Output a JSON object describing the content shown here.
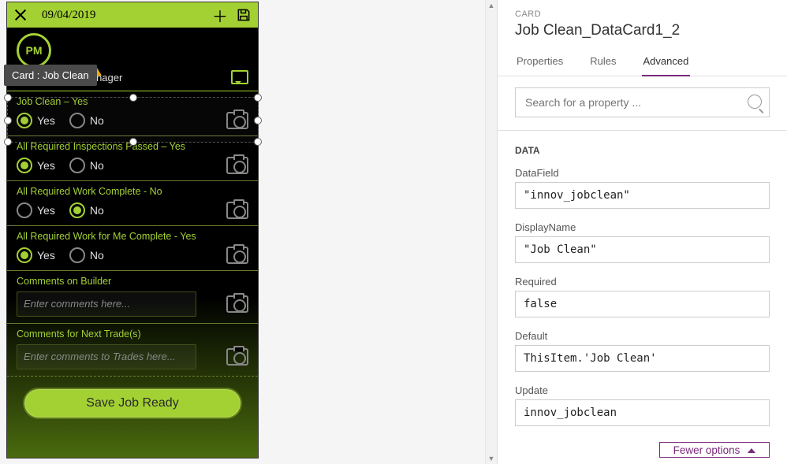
{
  "app": {
    "date": "09/04/2019",
    "pm_badge": "PM",
    "hr_role": "HR Manager",
    "tooltip": "Card : Job Clean",
    "fields": [
      {
        "label": "Job Clean – Yes",
        "yes": "Yes",
        "no": "No",
        "selected": "yes"
      },
      {
        "label": "All Required Inspections Passed – Yes",
        "yes": "Yes",
        "no": "No",
        "selected": "yes"
      },
      {
        "label": "All Required Work Complete - No",
        "yes": "Yes",
        "no": "No",
        "selected": "no"
      },
      {
        "label": "All Required Work for Me Complete - Yes",
        "yes": "Yes",
        "no": "No",
        "selected": "yes"
      }
    ],
    "comment_builder_label": "Comments on Builder",
    "comment_builder_placeholder": "Enter comments here...",
    "comment_trades_label": "Comments for Next Trade(s)",
    "comment_trades_placeholder": "Enter comments to Trades here...",
    "save_button": "Save Job Ready"
  },
  "panel": {
    "caption": "CARD",
    "title": "Job Clean_DataCard1_2",
    "tabs": {
      "properties": "Properties",
      "rules": "Rules",
      "advanced": "Advanced"
    },
    "search_placeholder": "Search for a property ...",
    "section_data": "DATA",
    "props": {
      "DataField": {
        "label": "DataField",
        "value": "\"innov_jobclean\""
      },
      "DisplayName": {
        "label": "DisplayName",
        "value": "\"Job Clean\""
      },
      "Required": {
        "label": "Required",
        "value": "false"
      },
      "Default": {
        "label": "Default",
        "value": "ThisItem.'Job Clean'"
      },
      "Update": {
        "label": "Update",
        "value": "innov_jobclean"
      }
    },
    "fewer_options": "Fewer options"
  }
}
